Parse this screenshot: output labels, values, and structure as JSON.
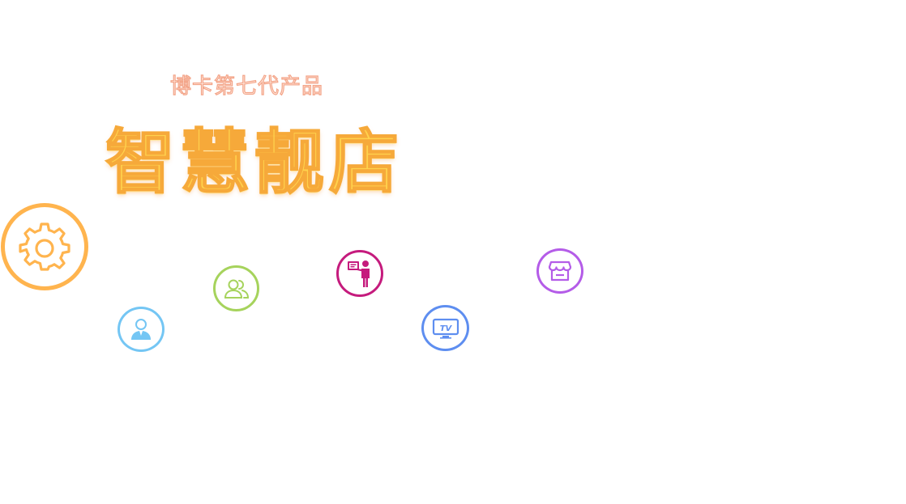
{
  "header": {
    "subtitle": "博卡第七代产品",
    "title": "智慧靓店"
  },
  "icons": [
    {
      "name": "settings-gear-icon",
      "color": "#ffb44e"
    },
    {
      "name": "user-avatar-icon",
      "color": "#74c6f4"
    },
    {
      "name": "user-group-icon",
      "color": "#a6d35c"
    },
    {
      "name": "presenter-icon",
      "color": "#c51b7d"
    },
    {
      "name": "tv-icon",
      "color": "#5e8ef0",
      "label": "TV"
    },
    {
      "name": "store-icon",
      "color": "#b45ce8"
    }
  ],
  "colors": {
    "subtitle_fill": "#ffe9df",
    "subtitle_stroke": "#f3a488",
    "title_fill": "#ffd24d",
    "title_stroke": "#f6a93a"
  }
}
